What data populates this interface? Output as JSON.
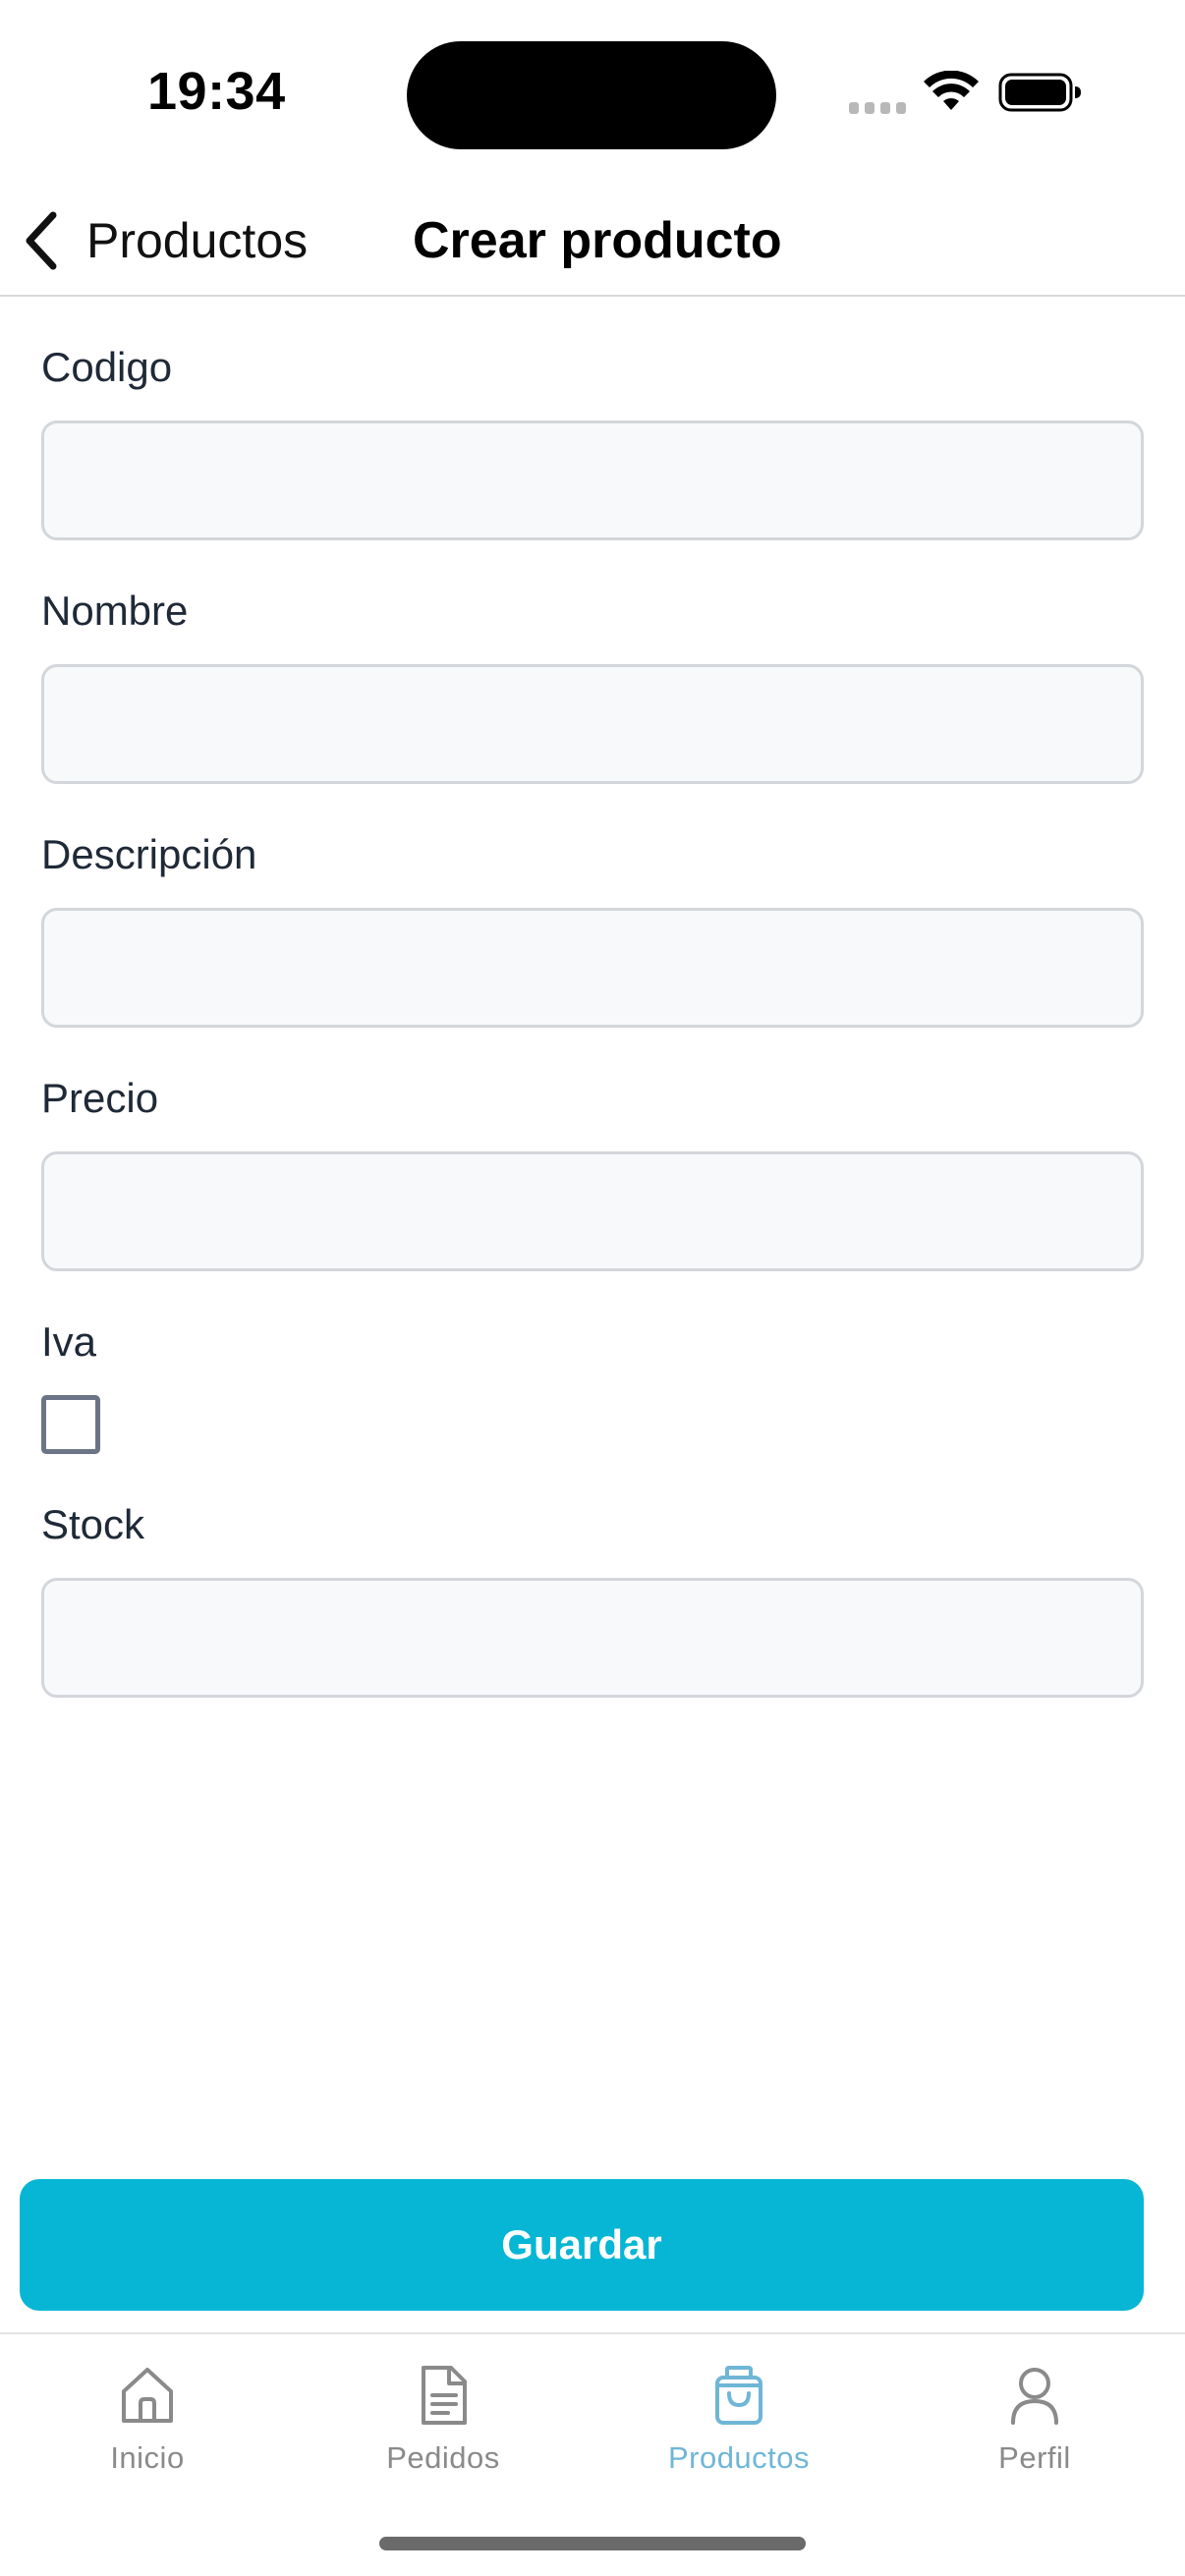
{
  "status_bar": {
    "time": "19:34"
  },
  "nav": {
    "back_label": "Productos",
    "title": "Crear producto"
  },
  "form": {
    "codigo": {
      "label": "Codigo",
      "value": ""
    },
    "nombre": {
      "label": "Nombre",
      "value": ""
    },
    "descripcion": {
      "label": "Descripción",
      "value": ""
    },
    "precio": {
      "label": "Precio",
      "value": ""
    },
    "iva": {
      "label": "Iva",
      "checked": false
    },
    "stock": {
      "label": "Stock",
      "value": ""
    }
  },
  "actions": {
    "save_label": "Guardar"
  },
  "tab_bar": {
    "items": [
      {
        "label": "Inicio",
        "icon": "home-icon",
        "active": false
      },
      {
        "label": "Pedidos",
        "icon": "document-icon",
        "active": false
      },
      {
        "label": "Productos",
        "icon": "shopping-bag-icon",
        "active": true
      },
      {
        "label": "Perfil",
        "icon": "user-icon",
        "active": false
      }
    ]
  },
  "colors": {
    "accent": "#06b6d4",
    "active_tab": "#6fb6d6",
    "inactive_tab": "#8a8a8a",
    "input_bg": "#f8f9fb",
    "input_border": "#d3d6da"
  }
}
